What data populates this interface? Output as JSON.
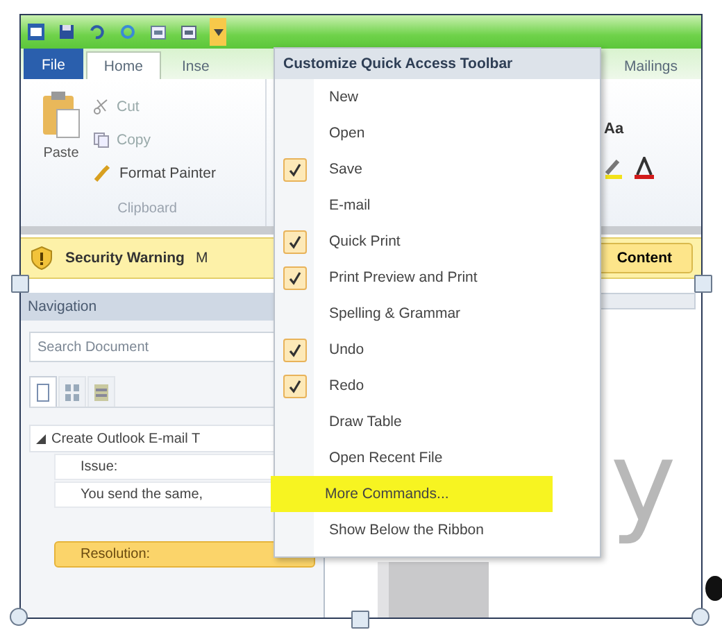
{
  "quick_access_toolbar": {
    "customize_open": true
  },
  "tabs": [
    {
      "label": "File",
      "kind": "file",
      "selected": false
    },
    {
      "label": "Home",
      "kind": "tab",
      "selected": true
    },
    {
      "label": "Inse",
      "kind": "tab",
      "selected": false
    },
    {
      "label": "Mailings",
      "kind": "tab",
      "selected": false
    }
  ],
  "ribbon": {
    "paste": "Paste",
    "cut": "Cut",
    "copy": "Copy",
    "format_painter": "Format Painter",
    "group": "Clipboard",
    "font_size": "Aa"
  },
  "message_bar": {
    "title": "Security Warning",
    "text": "M",
    "button": "Content"
  },
  "navigation": {
    "title": "Navigation",
    "search": {
      "placeholder": "Search Document"
    },
    "views": [
      {
        "kind": "headings",
        "selected": true
      },
      {
        "kind": "pages",
        "selected": false
      },
      {
        "kind": "results",
        "selected": false
      }
    ],
    "outline": [
      {
        "label": "Create Outlook E-mail T",
        "expanded": true,
        "children": [
          {
            "label": "Issue:",
            "selected": false
          },
          {
            "label": "You send the same,",
            "selected": false
          },
          {
            "label": "Resolution:",
            "selected": true
          }
        ]
      }
    ]
  },
  "menu": {
    "title": "Customize Quick Access Toolbar",
    "items": [
      {
        "label": "New",
        "checked": false,
        "highlighted": false
      },
      {
        "label": "Open",
        "checked": false,
        "highlighted": false
      },
      {
        "label": "Save",
        "checked": true,
        "highlighted": false
      },
      {
        "label": "E-mail",
        "checked": false,
        "highlighted": false
      },
      {
        "label": "Quick Print",
        "checked": true,
        "highlighted": false
      },
      {
        "label": "Print Preview and Print",
        "checked": true,
        "highlighted": false
      },
      {
        "label": "Spelling & Grammar",
        "checked": false,
        "highlighted": false
      },
      {
        "label": "Undo",
        "checked": true,
        "highlighted": false
      },
      {
        "label": "Redo",
        "checked": true,
        "highlighted": false
      },
      {
        "label": "Draw Table",
        "checked": false,
        "highlighted": false
      },
      {
        "label": "Open Recent File",
        "checked": false,
        "highlighted": false
      },
      {
        "label": "More Commands...",
        "checked": false,
        "highlighted": true
      },
      {
        "label": "Show Below the Ribbon",
        "checked": false,
        "highlighted": false
      }
    ]
  },
  "document": {
    "text": "y"
  }
}
